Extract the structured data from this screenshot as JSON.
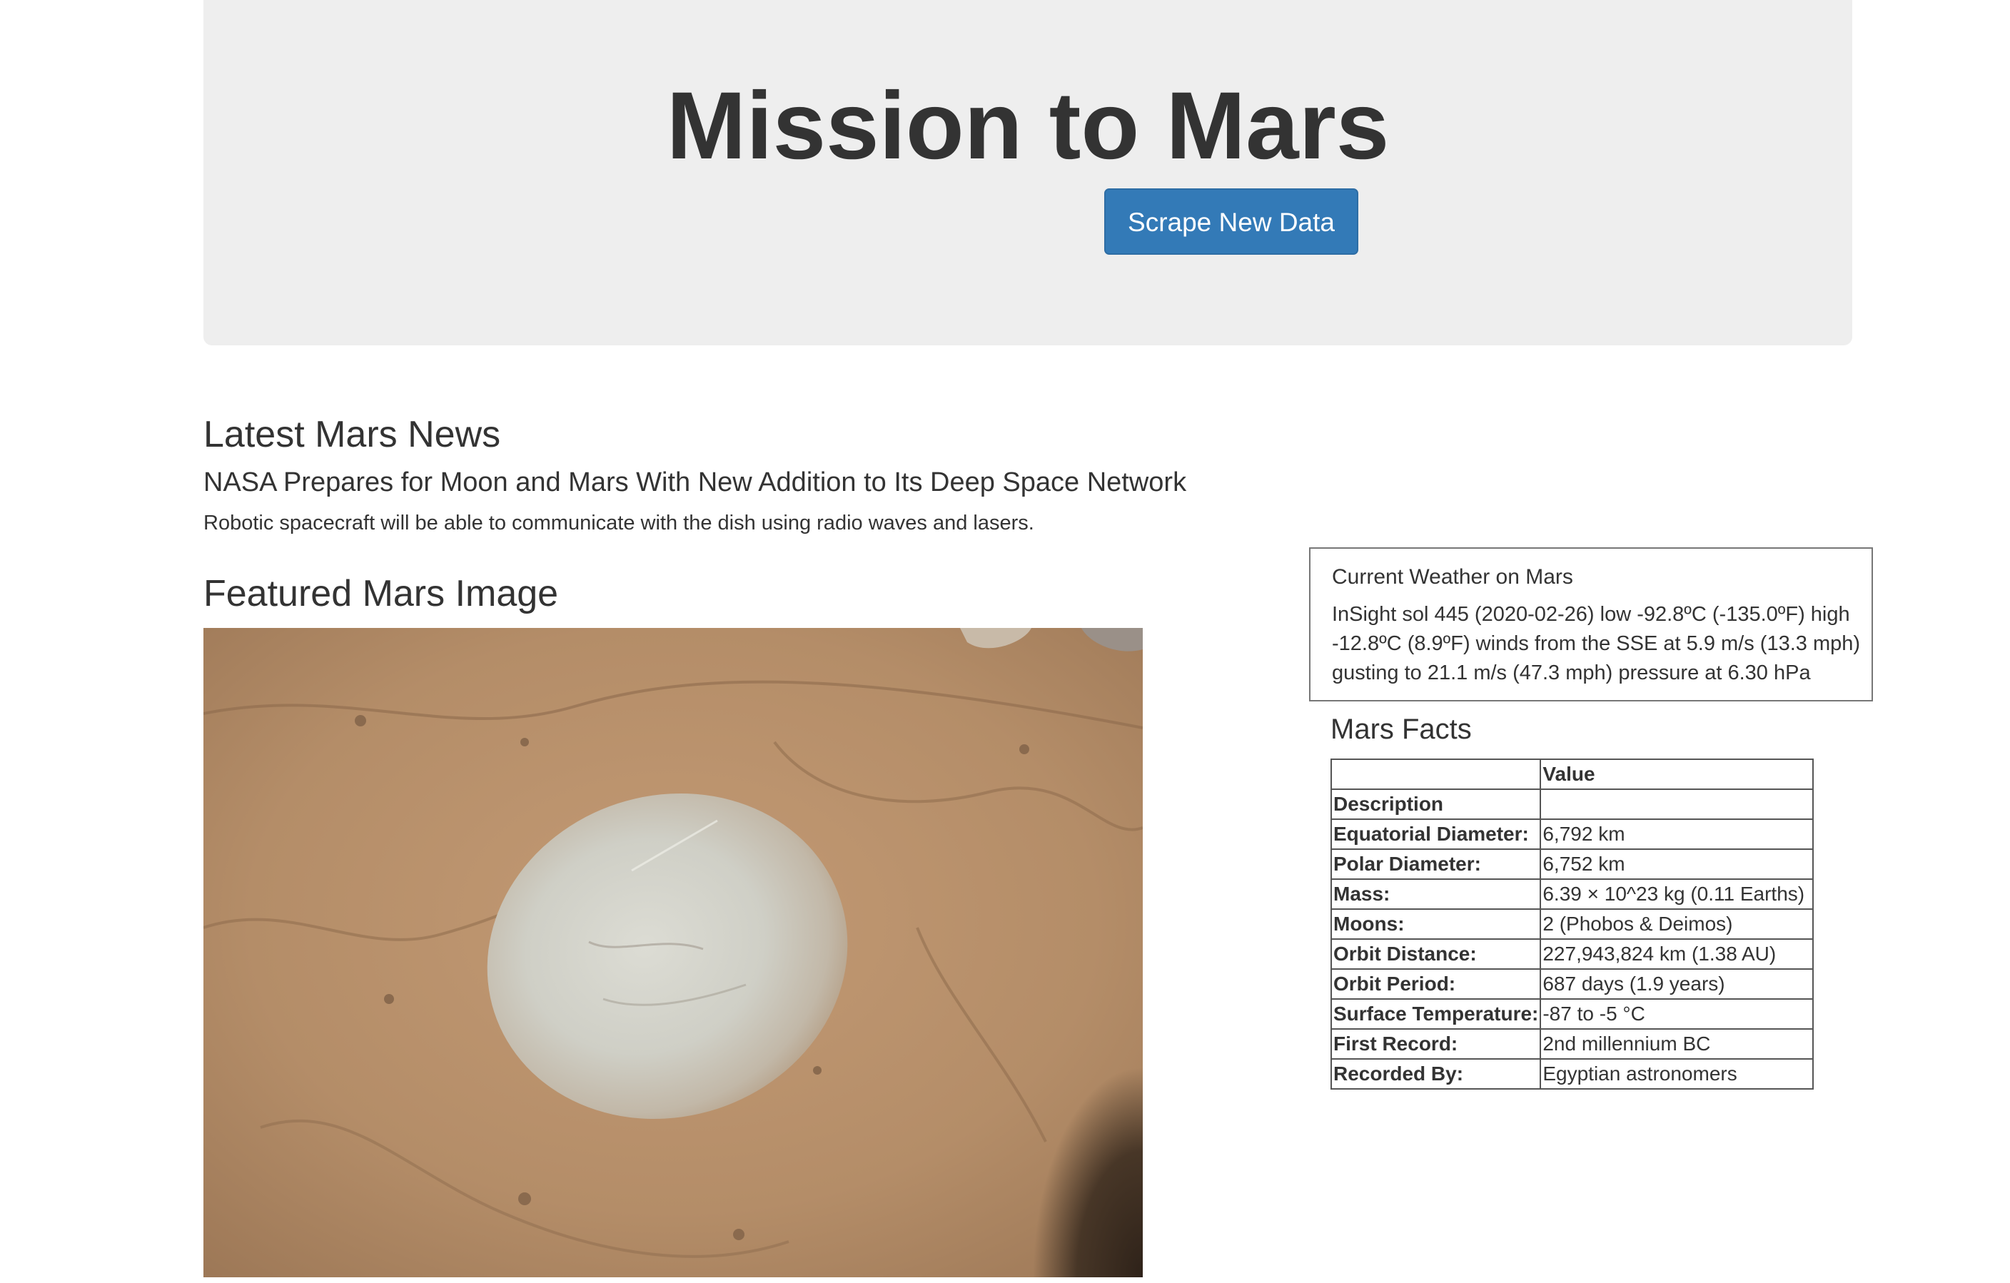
{
  "header": {
    "title": "Mission to Mars",
    "scrape_button_label": "Scrape New Data"
  },
  "news": {
    "heading": "Latest Mars News",
    "title": "NASA Prepares for Moon and Mars With New Addition to Its Deep Space Network",
    "teaser": "Robotic spacecraft will be able to communicate with the dish using radio waves and lasers."
  },
  "featured_image": {
    "heading": "Featured Mars Image",
    "alt": "Featured Mars Image"
  },
  "weather": {
    "title": "Current Weather on Mars",
    "text": "InSight sol 445 (2020-02-26) low -92.8ºC (-135.0ºF) high -12.8ºC (8.9ºF) winds from the SSE at 5.9 m/s (13.3 mph) gusting to 21.1 m/s (47.3 mph) pressure at 6.30 hPa"
  },
  "facts": {
    "heading": "Mars Facts",
    "value_header": "Value",
    "index_header": "Description",
    "rows": [
      {
        "key": "Equatorial Diameter:",
        "value": "6,792 km"
      },
      {
        "key": "Polar Diameter:",
        "value": "6,752 km"
      },
      {
        "key": "Mass:",
        "value": "6.39 × 10^23 kg (0.11 Earths)"
      },
      {
        "key": "Moons:",
        "value": "2 (Phobos & Deimos)"
      },
      {
        "key": "Orbit Distance:",
        "value": "227,943,824 km (1.38 AU)"
      },
      {
        "key": "Orbit Period:",
        "value": "687 days (1.9 years)"
      },
      {
        "key": "Surface Temperature:",
        "value": "-87 to -5 °C"
      },
      {
        "key": "First Record:",
        "value": "2nd millennium BC"
      },
      {
        "key": "Recorded By:",
        "value": "Egyptian astronomers"
      }
    ]
  },
  "colors": {
    "jumbotron_bg": "#eeeeee",
    "button_bg": "#337ab7",
    "text": "#333333"
  }
}
